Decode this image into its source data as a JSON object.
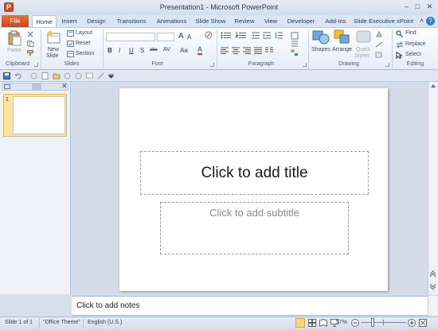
{
  "window": {
    "title": "Presentation1  -  Microsoft PowerPoint",
    "app_icon_letter": "P",
    "controls": {
      "minimize": "–",
      "maximize": "□",
      "close": "✕"
    },
    "ribbon_min": "˄",
    "help": "?"
  },
  "tabs": {
    "file": "File",
    "items": [
      "Home",
      "Insert",
      "Design",
      "Transitions",
      "Animations",
      "Slide Show",
      "Review",
      "View",
      "Developer",
      "Add-Ins",
      "Slide Executive xPoint"
    ],
    "active": "Home"
  },
  "ribbon": {
    "clipboard": {
      "paste": "Paste",
      "label": "Clipboard"
    },
    "slides": {
      "new_slide_1": "New",
      "new_slide_2": "Slide",
      "layout": "Layout",
      "reset": "Reset",
      "section": "Section",
      "label": "Slides"
    },
    "font": {
      "label": "Font",
      "grow": "A",
      "shrink": "A",
      "bold": "B",
      "italic": "I",
      "underline": "U",
      "strike": "S",
      "shadow": "abc",
      "spacing": "AV",
      "case": "Aa",
      "color": "A"
    },
    "paragraph": {
      "label": "Paragraph"
    },
    "drawing": {
      "shapes": "Shapes",
      "arrange": "Arrange",
      "quick_1": "Quick",
      "quick_2": "Styles",
      "label": "Drawing"
    },
    "editing": {
      "find": "Find",
      "replace": "Replace",
      "select": "Select",
      "label": "Editing"
    }
  },
  "slides_panel": {
    "slide_number": "1",
    "close": "✕"
  },
  "slide": {
    "title_placeholder": "Click to add title",
    "subtitle_placeholder": "Click to add subtitle"
  },
  "notes": {
    "placeholder": "Click to add notes"
  },
  "status": {
    "slide_counter": "Slide 1 of 1",
    "theme": "\"Office Theme\"",
    "language": "English (U.S.)",
    "zoom": "57%",
    "zoom_fraction": 0.57
  }
}
